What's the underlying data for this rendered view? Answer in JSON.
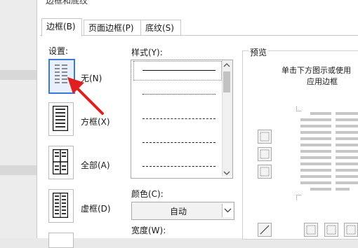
{
  "dialog": {
    "title": "边框和底纹"
  },
  "tabs": [
    {
      "label": "边框(B)",
      "active": true
    },
    {
      "label": "页面边框(P)",
      "active": false
    },
    {
      "label": "底纹(S)",
      "active": false
    }
  ],
  "settings": {
    "label": "设置:",
    "items": [
      {
        "label": "无(N)",
        "selected": true
      },
      {
        "label": "方框(X)",
        "selected": false
      },
      {
        "label": "全部(A)",
        "selected": false
      },
      {
        "label": "虚框(D)",
        "selected": false
      }
    ]
  },
  "style": {
    "label": "样式(Y):"
  },
  "color": {
    "label": "颜色(C):",
    "value": "自动"
  },
  "width": {
    "label": "宽度(W):"
  },
  "preview": {
    "label": "预览",
    "hint_line1": "单击下方图示或使用",
    "hint_line2": "应用边框"
  },
  "annotation": {
    "arrow_color": "#e02020"
  }
}
